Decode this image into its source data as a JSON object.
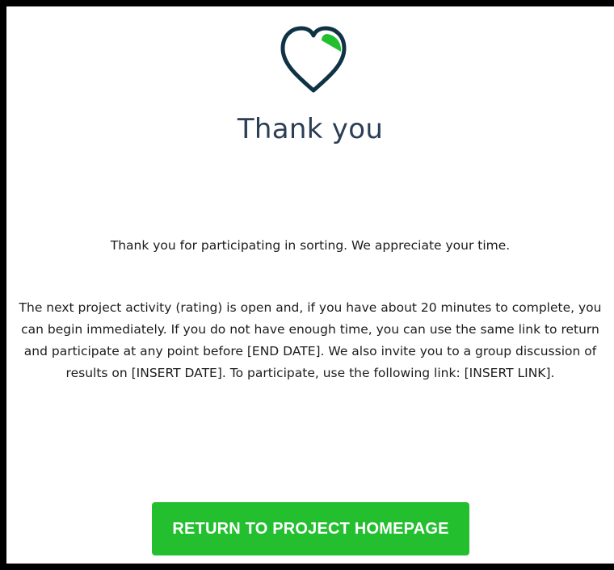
{
  "colors": {
    "heart_outline": "#0f3344",
    "heart_accent": "#23bf2f",
    "button_bg": "#23bf2f",
    "title_text": "#2c3e55"
  },
  "header": {
    "icon": "heart-icon",
    "title": "Thank you"
  },
  "main": {
    "message_1": "Thank you for participating in sorting. We appreciate your time.",
    "message_2": "The next project activity (rating) is open and, if you have about 20 minutes to complete, you can begin immediately. If you do not have enough time, you can use the same link to return and participate at any point before [END DATE]. We also invite you to a group discussion of results on [INSERT DATE]. To participate, use the following link: [INSERT LINK]."
  },
  "footer": {
    "return_button_label": "RETURN TO PROJECT HOMEPAGE"
  }
}
